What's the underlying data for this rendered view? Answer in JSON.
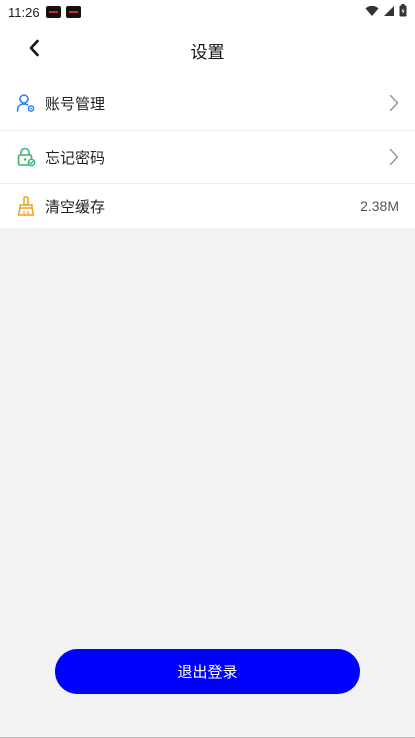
{
  "status_bar": {
    "time": "11:26",
    "icons": [
      "notification-icon",
      "notification-icon",
      "wifi-icon",
      "cell-signal-icon",
      "battery-icon"
    ]
  },
  "header": {
    "title": "设置",
    "back_icon": "chevron-left-icon"
  },
  "settings": {
    "items": [
      {
        "label": "账号管理",
        "icon": "user-gear-icon",
        "icon_color": "#2d7ff9",
        "trailing": "chevron-right-icon"
      },
      {
        "label": "忘记密码",
        "icon": "lock-check-icon",
        "icon_color": "#3cb371",
        "trailing": "chevron-right-icon"
      },
      {
        "label": "清空缓存",
        "icon": "broom-icon",
        "icon_color": "#f2a01c",
        "value": "2.38M"
      }
    ]
  },
  "logout": {
    "label": "退出登录",
    "color": "#0000ff"
  }
}
